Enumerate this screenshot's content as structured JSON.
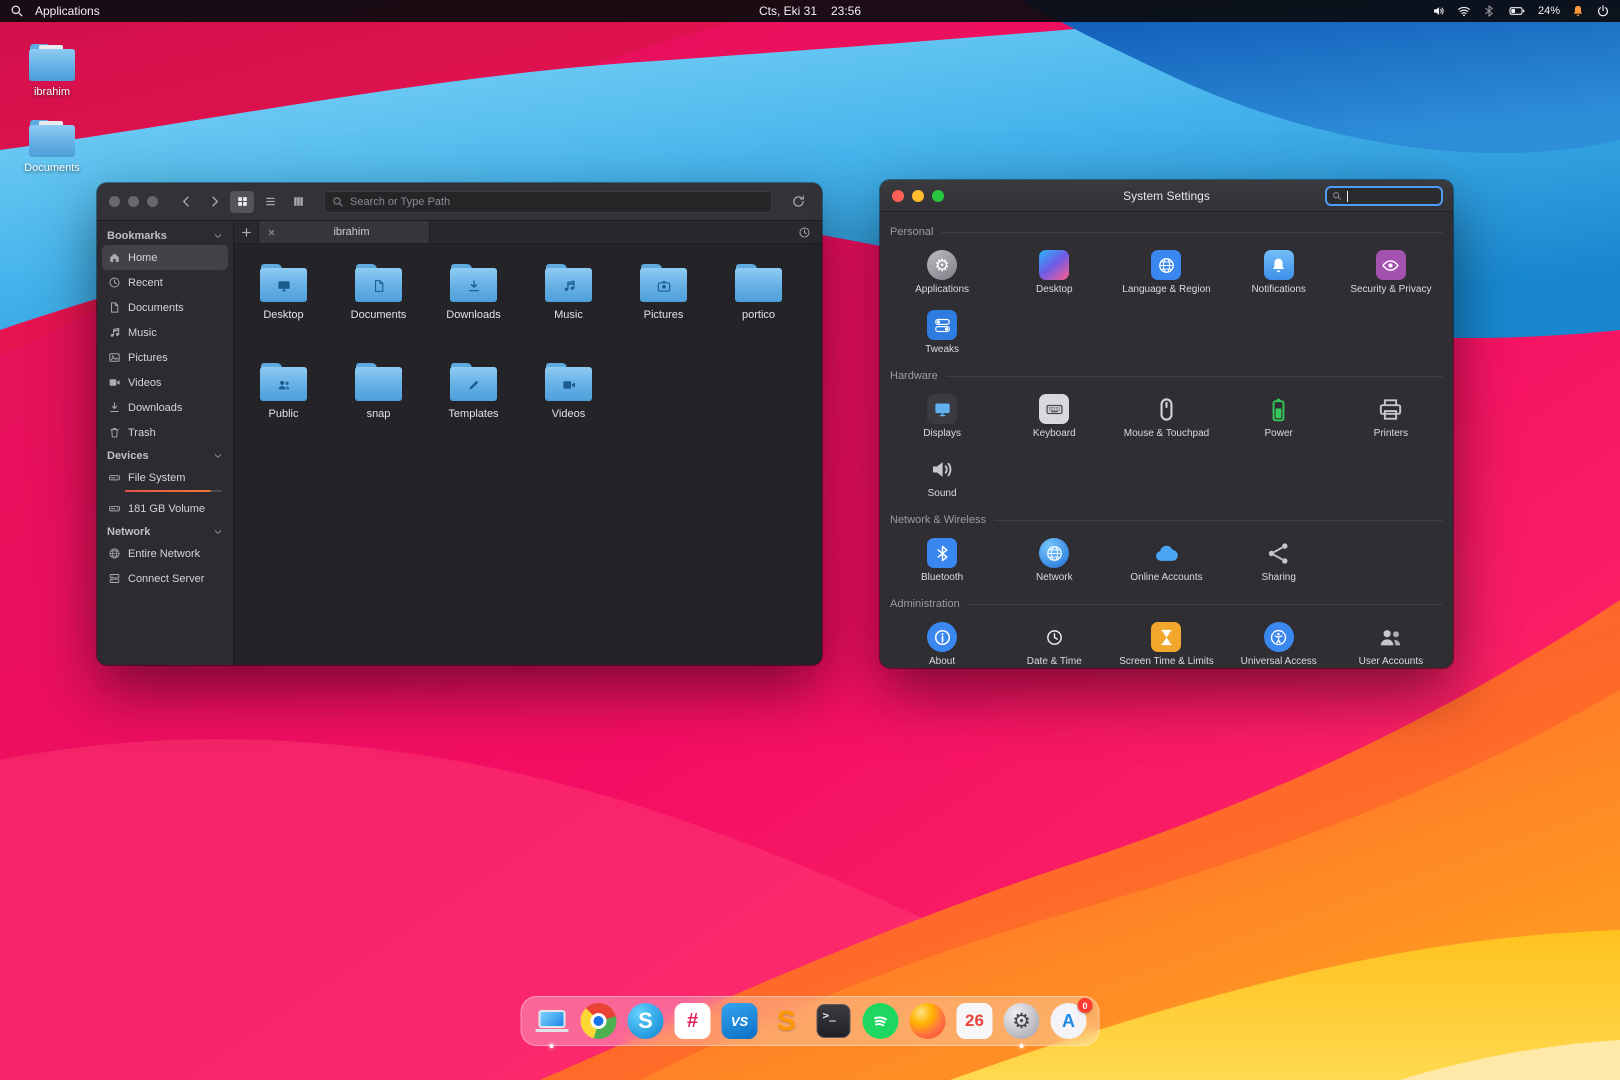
{
  "menubar": {
    "applications_label": "Applications",
    "date": "Cts, Eki 31",
    "time": "23:56",
    "battery_percent": "24%",
    "bell_color": "#ff9a3c"
  },
  "desktop_icons": [
    {
      "label": "ibrahim"
    },
    {
      "label": "Documents"
    }
  ],
  "file_manager": {
    "search_placeholder": "Search or Type Path",
    "tab_title": "ibrahim",
    "sidebar_sections": [
      {
        "title": "Bookmarks",
        "items": [
          {
            "label": "Home",
            "icon": "home",
            "selected": true
          },
          {
            "label": "Recent",
            "icon": "clock"
          },
          {
            "label": "Documents",
            "icon": "doc"
          },
          {
            "label": "Music",
            "icon": "note"
          },
          {
            "label": "Pictures",
            "icon": "image"
          },
          {
            "label": "Videos",
            "icon": "video"
          },
          {
            "label": "Downloads",
            "icon": "download"
          },
          {
            "label": "Trash",
            "icon": "trash"
          }
        ]
      },
      {
        "title": "Devices",
        "items": [
          {
            "label": "File System",
            "icon": "disk",
            "usage_bar": true
          },
          {
            "label": "181 GB Volume",
            "icon": "disk"
          }
        ]
      },
      {
        "title": "Network",
        "items": [
          {
            "label": "Entire Network",
            "icon": "globe"
          },
          {
            "label": "Connect Server",
            "icon": "server"
          }
        ]
      }
    ],
    "folders": [
      {
        "label": "Desktop",
        "emblem": "display"
      },
      {
        "label": "Documents",
        "emblem": "doc"
      },
      {
        "label": "Downloads",
        "emblem": "download"
      },
      {
        "label": "Music",
        "emblem": "note"
      },
      {
        "label": "Pictures",
        "emblem": "camera"
      },
      {
        "label": "portico",
        "emblem": ""
      },
      {
        "label": "Public",
        "emblem": "users"
      },
      {
        "label": "snap",
        "emblem": ""
      },
      {
        "label": "Templates",
        "emblem": "pencil"
      },
      {
        "label": "Videos",
        "emblem": "video"
      }
    ]
  },
  "settings": {
    "title": "System Settings",
    "search_value": "",
    "sections": [
      {
        "title": "Personal",
        "items": [
          {
            "label": "Applications",
            "icon": {
              "glyph": "⚙",
              "shape": "circle",
              "bg": "linear-gradient(145deg,#bcbdc2,#7f8088)",
              "fg": "#ffffff"
            }
          },
          {
            "label": "Desktop",
            "icon": {
              "shape": "square",
              "bg": "linear-gradient(140deg,#29b7f5 0%,#6c5ce7 48%,#ff5d8f 100%)"
            }
          },
          {
            "label": "Language & Region",
            "icon": {
              "sym": "globe",
              "shape": "square",
              "bg": "#3b87f0",
              "fg": "#ffffff"
            }
          },
          {
            "label": "Notifications",
            "icon": {
              "sym": "bell",
              "shape": "square",
              "bg": "linear-gradient(180deg,#74bdf8,#3c8fe8)",
              "fg": "#ffffff"
            }
          },
          {
            "label": "Security & Privacy",
            "icon": {
              "sym": "eye",
              "shape": "square",
              "bg": "#a452b0",
              "fg": "#ffffff"
            }
          },
          {
            "label": "Tweaks",
            "icon": {
              "sym": "toggles",
              "shape": "square",
              "bg": "#2f7ce0",
              "fg": "#ffffff"
            }
          }
        ]
      },
      {
        "title": "Hardware",
        "items": [
          {
            "label": "Displays",
            "icon": {
              "sym": "display",
              "shape": "square",
              "bg": "#3a3a40",
              "fg": "#62b2f2"
            }
          },
          {
            "label": "Keyboard",
            "icon": {
              "sym": "keyboard",
              "shape": "square",
              "bg": "#d8d8dd",
              "fg": "#47474d"
            }
          },
          {
            "label": "Mouse & Touchpad",
            "icon": {
              "sym": "mouse",
              "shape": "plain",
              "fg": "#cfd0d5"
            }
          },
          {
            "label": "Power",
            "icon": {
              "sym": "battv",
              "shape": "plain",
              "fg": "#35c759"
            }
          },
          {
            "label": "Printers",
            "icon": {
              "sym": "printer",
              "shape": "plain",
              "fg": "#c6c7cc"
            }
          },
          {
            "label": "Sound",
            "icon": {
              "sym": "volume",
              "shape": "plain",
              "fg": "#c6c7cc"
            }
          }
        ]
      },
      {
        "title": "Network & Wireless",
        "items": [
          {
            "label": "Bluetooth",
            "icon": {
              "sym": "bluetooth",
              "shape": "square",
              "bg": "#3b87f0",
              "fg": "#ffffff"
            }
          },
          {
            "label": "Network",
            "icon": {
              "sym": "globe",
              "shape": "circle",
              "bg": "radial-gradient(circle at 35% 30%,#79c7ff,#1d6fd6)",
              "fg": "#f2faff"
            }
          },
          {
            "label": "Online Accounts",
            "icon": {
              "sym": "cloud",
              "shape": "plain",
              "fg": "#4ba5f5"
            }
          },
          {
            "label": "Sharing",
            "icon": {
              "sym": "share",
              "shape": "plain",
              "fg": "#c6c7cc"
            }
          }
        ]
      },
      {
        "title": "Administration",
        "items": [
          {
            "label": "About",
            "icon": {
              "sym": "info",
              "shape": "circle",
              "bg": "#3b87f0",
              "fg": "#ffffff"
            }
          },
          {
            "label": "Date & Time",
            "icon": {
              "sym": "clock",
              "shape": "square",
              "bg": "#303034",
              "fg": "#f2f2f4"
            }
          },
          {
            "label": "Screen Time & Limits",
            "icon": {
              "sym": "hourglass",
              "shape": "square",
              "bg": "#f0a72c",
              "fg": "#ffffff"
            }
          },
          {
            "label": "Universal Access",
            "icon": {
              "sym": "access",
              "shape": "circle",
              "bg": "#3b87f0",
              "fg": "#ffffff"
            }
          },
          {
            "label": "User Accounts",
            "icon": {
              "sym": "users",
              "shape": "plain",
              "fg": "#c6c7cc"
            }
          }
        ]
      }
    ]
  },
  "dock": {
    "items": [
      {
        "name": "file-manager",
        "style": "computer",
        "open": true
      },
      {
        "name": "chrome",
        "style": "chrome"
      },
      {
        "name": "skype",
        "style": "skype",
        "glyph": "S"
      },
      {
        "name": "slack",
        "style": "slack",
        "glyph": "#"
      },
      {
        "name": "vscode",
        "style": "vscode",
        "glyph": "VS"
      },
      {
        "name": "sublime-text",
        "style": "sublime",
        "glyph": "S"
      },
      {
        "name": "terminal",
        "style": "terminal",
        "glyph": ">_"
      },
      {
        "name": "spotify",
        "style": "spotify"
      },
      {
        "name": "firefox",
        "style": "firefox"
      },
      {
        "name": "calendar",
        "style": "calendar",
        "day": "26"
      },
      {
        "name": "system-settings",
        "style": "gear",
        "glyph": "⚙",
        "open": true
      },
      {
        "name": "app-store",
        "style": "appstore",
        "glyph": "A",
        "badge": "0"
      }
    ]
  }
}
